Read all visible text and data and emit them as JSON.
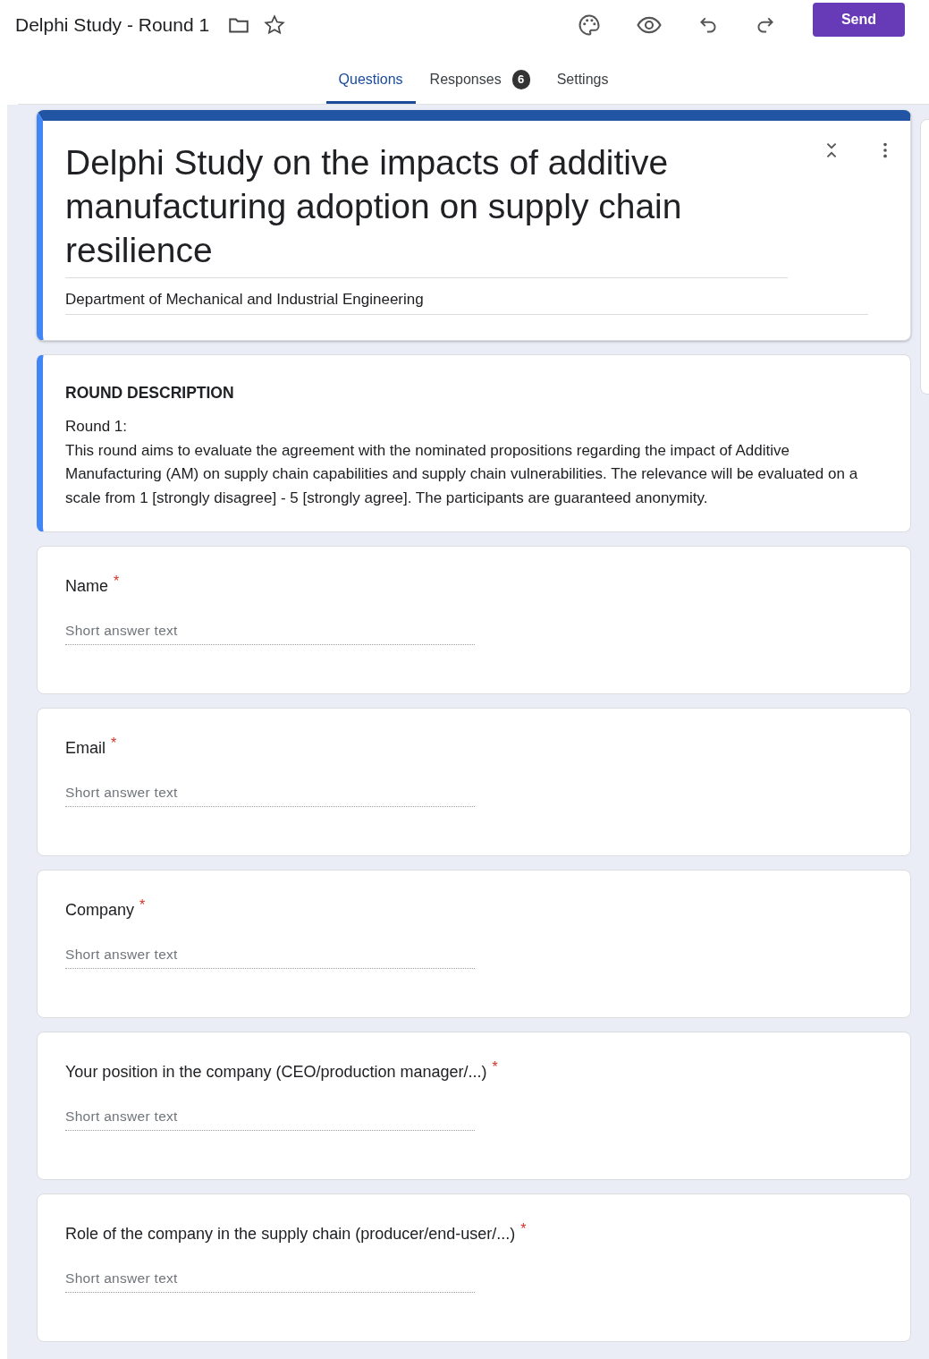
{
  "header": {
    "title": "Delphi Study - Round 1",
    "send_label": "Send"
  },
  "tabs": [
    {
      "label": "Questions",
      "selected": true
    },
    {
      "label": "Responses",
      "selected": false,
      "badge": "6"
    },
    {
      "label": "Settings",
      "selected": false
    }
  ],
  "form_header": {
    "title": "Delphi Study on the impacts of additive manufacturing adoption on supply chain resilience",
    "description": "Department of Mechanical and Industrial Engineering",
    "selected": true
  },
  "section": {
    "heading": "ROUND DESCRIPTION",
    "lines": [
      "Round 1:",
      "This round aims to evaluate the agreement with the nominated propositions regarding the impact of Additive Manufacturing (AM) on supply chain capabilities and supply chain vulnerabilities. The relevance will be evaluated on a scale from 1 [strongly disagree] - 5 [strongly agree]. The participants are guaranteed anonymity."
    ],
    "selected": true
  },
  "questions": [
    {
      "label": "Name",
      "required_mark": "*",
      "placeholder": "Short answer text"
    },
    {
      "label": "Email",
      "required_mark": "*",
      "placeholder": "Short answer text"
    },
    {
      "label": "Company",
      "required_mark": "*",
      "placeholder": "Short answer text"
    },
    {
      "label": "Your position in the company (CEO/production manager/...)",
      "required_mark": "*",
      "placeholder": "Short answer text"
    },
    {
      "label": "Role of the company in the supply chain (producer/end-user/...)",
      "required_mark": "*",
      "placeholder": "Short answer text"
    }
  ]
}
